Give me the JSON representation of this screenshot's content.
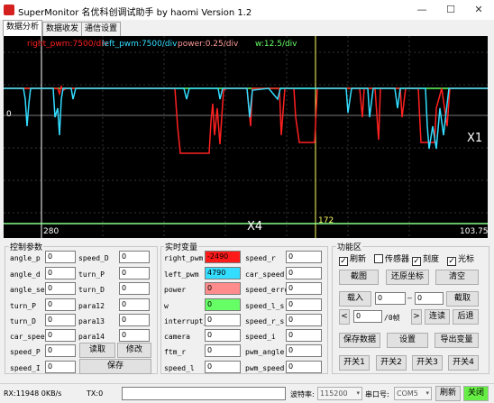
{
  "window": {
    "title": "SuperMonitor 名优科创调试助手 by haomi   Version 1.2",
    "minimize": "—",
    "maximize": "☐",
    "close": "✕"
  },
  "tabs": [
    "数据分析",
    "数据收发",
    "通信设置"
  ],
  "scope": {
    "legend": [
      {
        "text": "right_pwm:7500/div",
        "color": "#ff2020"
      },
      {
        "text": "left_pwm:7500/div",
        "color": "#33ddff"
      },
      {
        "text": "power:0.25/div",
        "color": "#ff9a9a"
      },
      {
        "text": "w:12.5/div",
        "color": "#66ff66"
      }
    ],
    "zero_label": "0",
    "x1_label": "X1",
    "x4_label": "X4",
    "left_value": "280",
    "cursor_value": "172",
    "right_value": "103.75"
  },
  "params": {
    "title": "控制参数",
    "left": [
      {
        "label": "angle_p",
        "value": "0"
      },
      {
        "label": "angle_d",
        "value": "0"
      },
      {
        "label": "angle_set",
        "value": "0"
      },
      {
        "label": "turn_P",
        "value": "0"
      },
      {
        "label": "turn_D",
        "value": "0"
      },
      {
        "label": "car_speed",
        "value": "0"
      },
      {
        "label": "speed_P",
        "value": "0"
      },
      {
        "label": "speed_I",
        "value": "0"
      }
    ],
    "right": [
      {
        "label": "speed_D",
        "value": "0"
      },
      {
        "label": "turn_P",
        "value": "0"
      },
      {
        "label": "turn_D",
        "value": "0"
      },
      {
        "label": "para12",
        "value": "0"
      },
      {
        "label": "para13",
        "value": "0"
      },
      {
        "label": "para14",
        "value": "0"
      }
    ],
    "read_button": "读取",
    "modify_button": "修改",
    "save_button": "保存"
  },
  "realtime": {
    "title": "实时变量",
    "left": [
      {
        "label": "right_pwm",
        "value": "-2490",
        "color": "#ff1a1a"
      },
      {
        "label": "left_pwm",
        "value": "4790",
        "color": "#33ddff"
      },
      {
        "label": "power",
        "value": "0",
        "color": "#ff8c8c"
      },
      {
        "label": "w",
        "value": "0",
        "color": "#66ff66"
      },
      {
        "label": "interrupt_m",
        "value": "0",
        "color": "#ffffff"
      },
      {
        "label": "camera",
        "value": "0",
        "color": "#ffffff"
      },
      {
        "label": "ftm_r",
        "value": "0",
        "color": "#ffffff"
      },
      {
        "label": "speed_l",
        "value": "0",
        "color": "#ffffff"
      }
    ],
    "right": [
      {
        "label": "speed_r",
        "value": "0"
      },
      {
        "label": "car_speed",
        "value": "0"
      },
      {
        "label": "speed_error",
        "value": "0"
      },
      {
        "label": "speed_l_s",
        "value": "0"
      },
      {
        "label": "speed_r_s",
        "value": "0"
      },
      {
        "label": "speed_i",
        "value": "0"
      },
      {
        "label": "pwm_angle",
        "value": "0"
      },
      {
        "label": "pwm_speed",
        "value": "0"
      }
    ]
  },
  "functions": {
    "title": "功能区",
    "checks": [
      {
        "label": "刷新",
        "checked": true
      },
      {
        "label": "传感器",
        "checked": false
      },
      {
        "label": "刻度",
        "checked": true
      },
      {
        "label": "光标",
        "checked": true
      }
    ],
    "screenshot": "截图",
    "restore": "还原坐标",
    "clear": "清空",
    "load": "载入",
    "load_from": "0",
    "load_dash": "—",
    "load_to": "0",
    "cut": "截取",
    "step_prev": "<",
    "frame_value": "0",
    "frame_unit": "/0帧",
    "step_next": ">",
    "continuous": "连读",
    "back": "后退",
    "save_data": "保存数据",
    "settings": "设置",
    "export": "导出变量",
    "switch1": "开关1",
    "switch2": "开关2",
    "switch3": "开关3",
    "switch4": "开关4"
  },
  "status": {
    "rx": "RX:11948 0KB/s",
    "tx": "TX:0",
    "baud_label": "波特率:",
    "baud_value": "115200",
    "port_label": "串口号:",
    "port_value": "COM5",
    "refresh": "刷新",
    "close_port": "关闭"
  }
}
